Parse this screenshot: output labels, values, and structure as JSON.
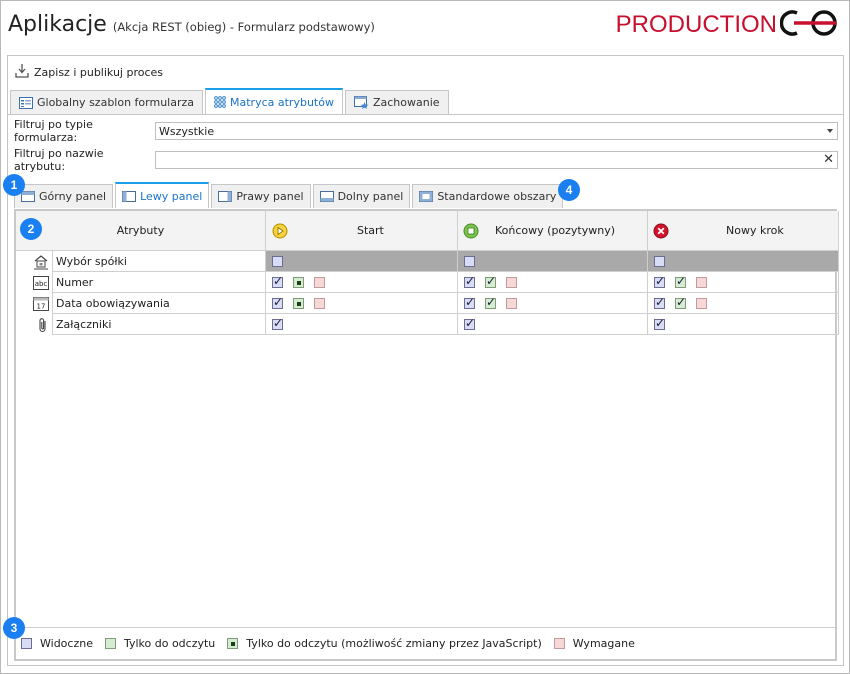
{
  "header": {
    "title": "Aplikacje",
    "subtitle": "(Akcja REST (obieg) - Formularz podstawowy)",
    "brand": "PRODUCTION"
  },
  "toolbar": {
    "save_label": "Zapisz i publikuj proces"
  },
  "tabs_top": [
    {
      "label": "Globalny szablon formularza",
      "icon": "form-template-icon",
      "active": false
    },
    {
      "label": "Matryca atrybutów",
      "icon": "matrix-icon",
      "active": true
    },
    {
      "label": "Zachowanie",
      "icon": "behavior-icon",
      "active": false
    }
  ],
  "filters": {
    "form_type_label": "Filtruj po typie formularza:",
    "form_type_value": "Wszystkie",
    "attr_name_label": "Filtruj po nazwie atrybutu:",
    "attr_name_value": ""
  },
  "tabs_inner": [
    {
      "label": "Górny panel",
      "active": false
    },
    {
      "label": "Lewy panel",
      "active": true
    },
    {
      "label": "Prawy panel",
      "active": false
    },
    {
      "label": "Dolny panel",
      "active": false
    },
    {
      "label": "Standardowe obszary",
      "active": false
    }
  ],
  "grid": {
    "attr_header": "Atrybuty",
    "columns": [
      {
        "label": "Start",
        "icon": "start-step-icon",
        "color": "#f2c200"
      },
      {
        "label": "Końcowy (pozytywny)",
        "icon": "positive-end-icon",
        "color": "#6cbd45"
      },
      {
        "label": "Nowy krok",
        "icon": "rejected-step-icon",
        "color": "#d0142c"
      }
    ],
    "rows": [
      {
        "label": "Wybór spółki",
        "icon": "company-choice-icon",
        "gray": true,
        "cells": [
          [
            "visible"
          ],
          [
            "visible"
          ],
          [
            "visible"
          ]
        ]
      },
      {
        "label": "Numer",
        "icon": "text-field-icon",
        "gray": false,
        "cells": [
          [
            "visible-checked",
            "jsro",
            "required"
          ],
          [
            "visible-checked",
            "readonly-checked",
            "required"
          ],
          [
            "visible-checked",
            "readonly-checked",
            "required"
          ]
        ]
      },
      {
        "label": "Data obowiązywania",
        "icon": "date-icon",
        "gray": false,
        "cells": [
          [
            "visible-checked",
            "jsro",
            "required"
          ],
          [
            "visible-checked",
            "readonly-checked",
            "required"
          ],
          [
            "visible-checked",
            "readonly-checked",
            "required"
          ]
        ]
      },
      {
        "label": "Załączniki",
        "icon": "attachment-icon",
        "gray": false,
        "cells": [
          [
            "visible-checked"
          ],
          [
            "visible-checked"
          ],
          [
            "visible-checked"
          ]
        ]
      }
    ]
  },
  "legend": [
    {
      "label": "Widoczne",
      "kind": "visible"
    },
    {
      "label": "Tylko do odczytu",
      "kind": "readonly"
    },
    {
      "label": "Tylko do odczytu (możliwość zmiany przez JavaScript)",
      "kind": "jsro"
    },
    {
      "label": "Wymagane",
      "kind": "required"
    }
  ],
  "badges": [
    "1",
    "2",
    "3",
    "4"
  ]
}
